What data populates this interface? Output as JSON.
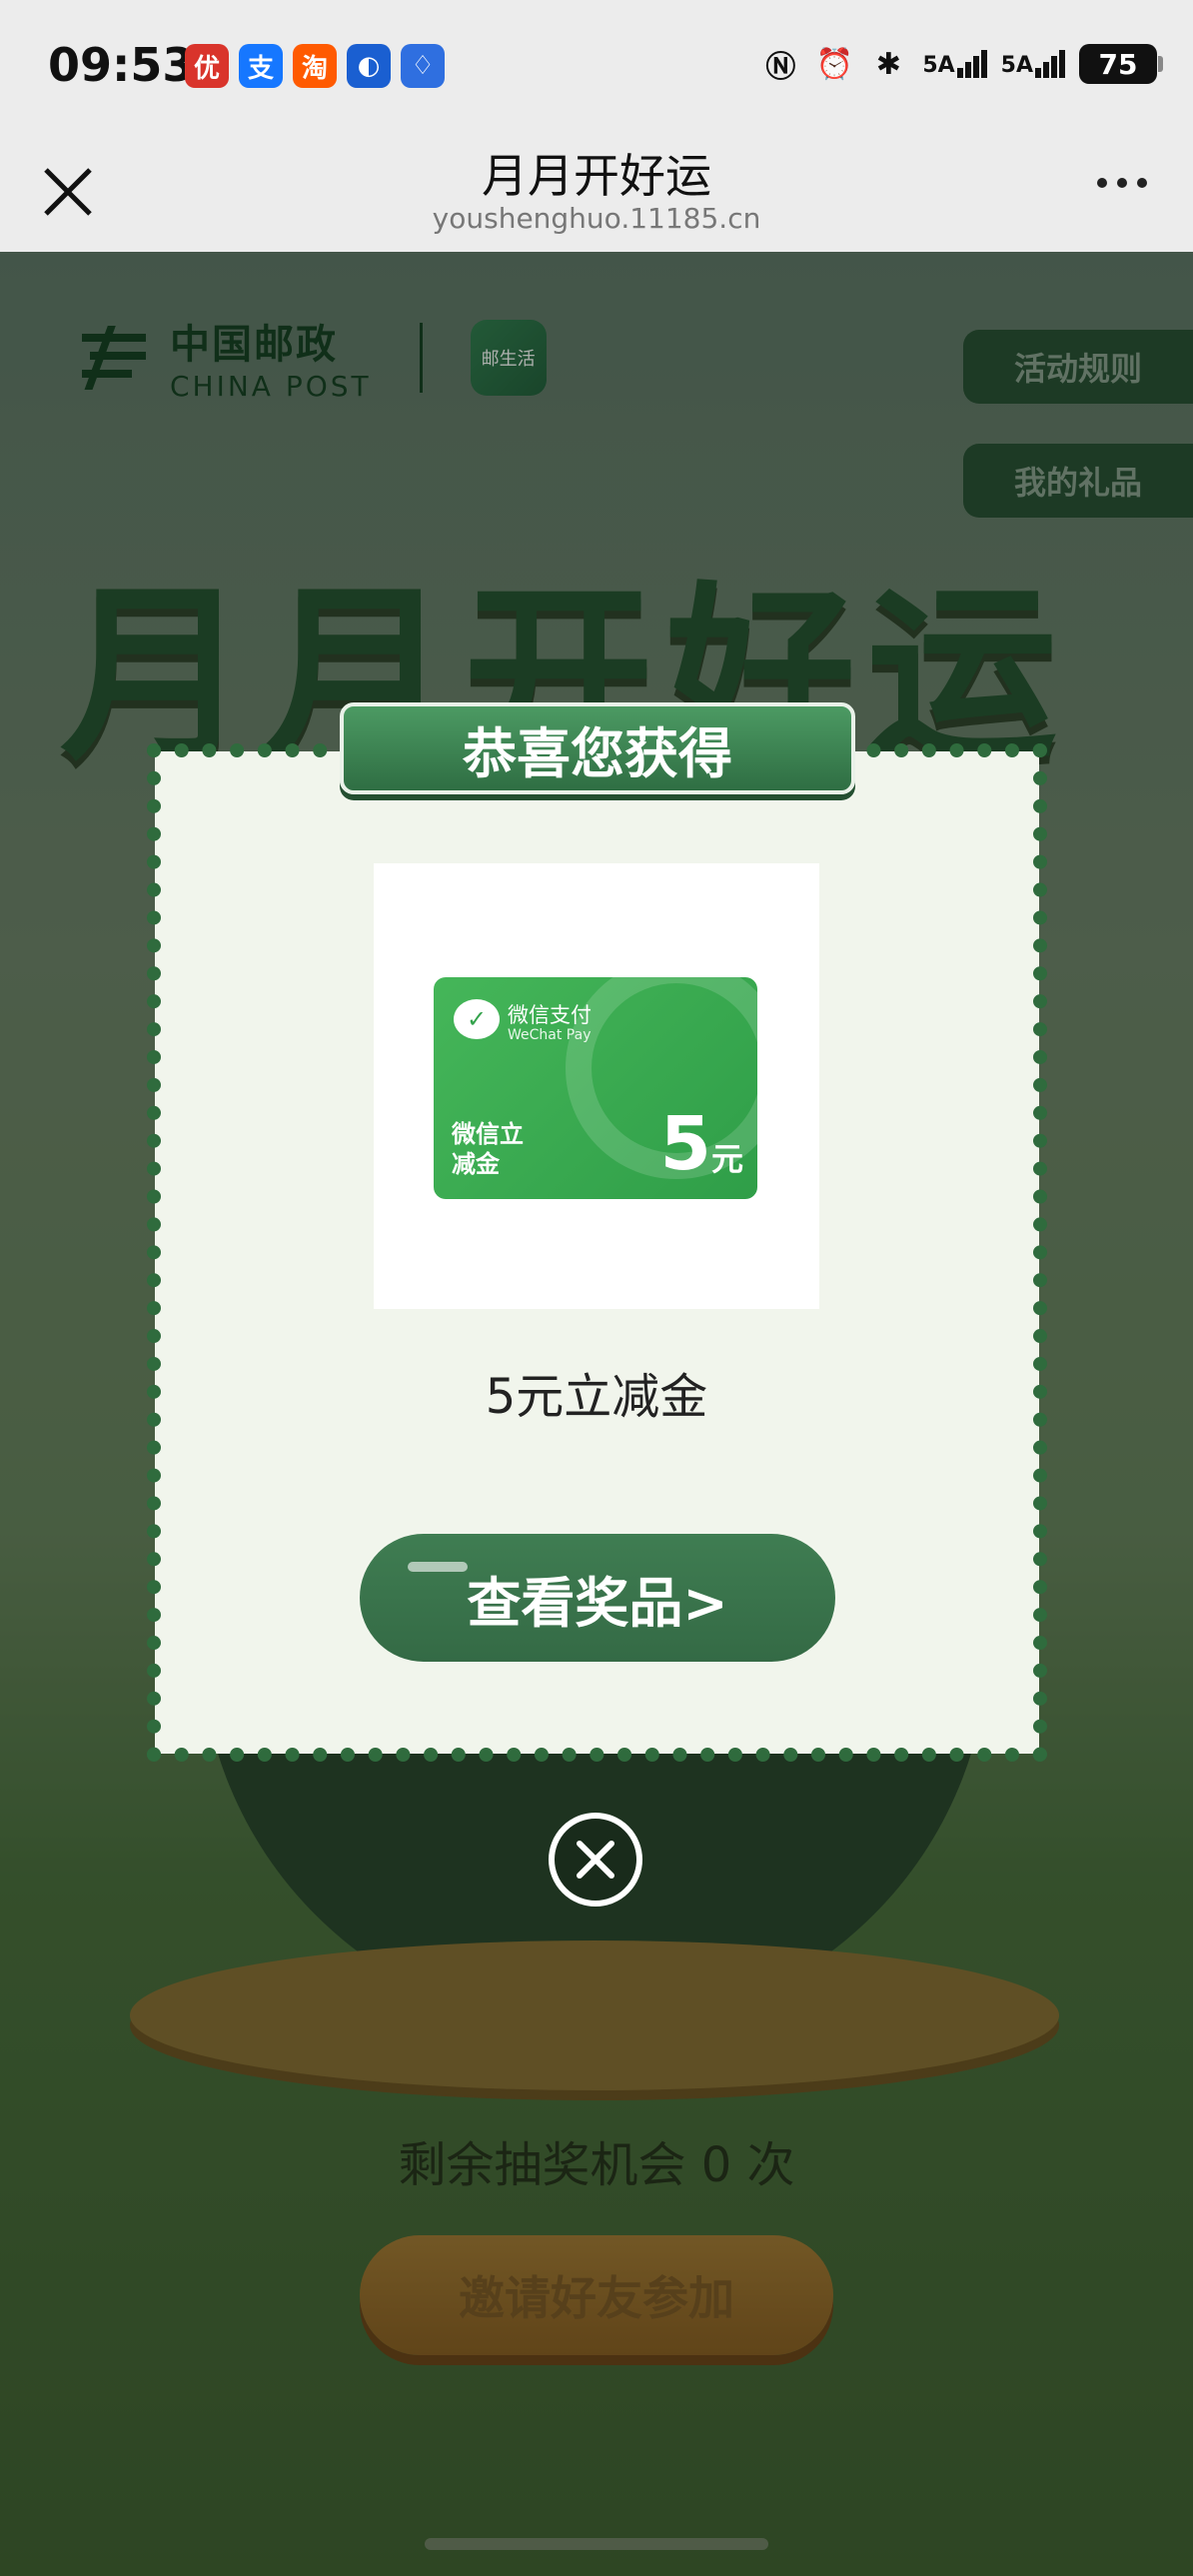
{
  "status_bar": {
    "time": "09:53",
    "apps": [
      {
        "name": "app1-icon",
        "glyph": "优",
        "color": "#d9342b"
      },
      {
        "name": "alipay-icon",
        "glyph": "支",
        "color": "#1677ff"
      },
      {
        "name": "taobao-icon",
        "glyph": "淘",
        "color": "#ff5a00"
      },
      {
        "name": "app4-icon",
        "glyph": "◐",
        "color": "#1a5fd1"
      },
      {
        "name": "bulb-app-icon",
        "glyph": "♢",
        "color": "#2f6fe0"
      }
    ],
    "signal1": "5A",
    "signal2": "5A",
    "battery": "75"
  },
  "navbar": {
    "title": "月月开好运",
    "url": "youshenghuo.11185.cn"
  },
  "page": {
    "logo_cn": "中国邮政",
    "logo_en": "CHINA POST",
    "app_logo_text": "邮生活",
    "rules_button": "活动规则",
    "gifts_button": "我的礼品",
    "hero_title": "月月开好运",
    "chances_text": "剩余抽奖机会 0 次",
    "invite_button": "邀请好友参加"
  },
  "modal": {
    "header": "恭喜您获得",
    "card_brand_cn": "微信支付",
    "card_brand_en": "WeChat Pay",
    "card_name": "微信立减金",
    "card_amount": "5",
    "card_unit": "元",
    "prize_name": "5元立减金",
    "view_button": "查看奖品>"
  },
  "colors": {
    "accent_green": "#2f6e43",
    "modal_bg": "#f1f5ec",
    "card_green": "#3aaa52"
  }
}
